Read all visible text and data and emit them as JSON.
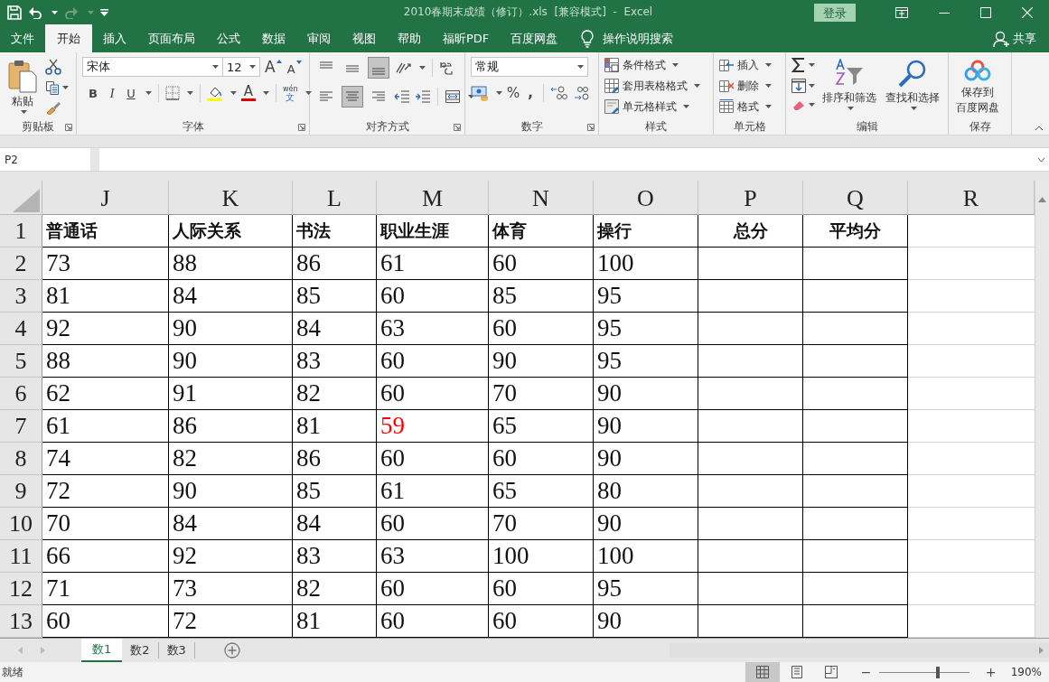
{
  "window": {
    "title": "2010春期末成绩（修订）.xls  [兼容模式]  -  Excel",
    "login": "登录"
  },
  "menu_tabs": [
    {
      "label": "文件",
      "selected": false
    },
    {
      "label": "开始",
      "selected": true
    },
    {
      "label": "插入",
      "selected": false
    },
    {
      "label": "页面布局",
      "selected": false
    },
    {
      "label": "公式",
      "selected": false
    },
    {
      "label": "数据",
      "selected": false
    },
    {
      "label": "审阅",
      "selected": false
    },
    {
      "label": "视图",
      "selected": false
    },
    {
      "label": "帮助",
      "selected": false
    },
    {
      "label": "福昕PDF",
      "selected": false
    },
    {
      "label": "百度网盘",
      "selected": false
    }
  ],
  "tell_me": "操作说明搜索",
  "share": "共享",
  "ribbon": {
    "clipboard": {
      "label": "剪贴板",
      "paste": "粘贴"
    },
    "font": {
      "label": "字体",
      "font_name": "宋体",
      "font_size": "12",
      "grow": "A",
      "shrink": "A",
      "bold": "B",
      "italic": "I",
      "underline": "U",
      "font_color": "A",
      "phonetic_top": "wén",
      "phonetic_bottom": "文"
    },
    "alignment": {
      "label": "对齐方式",
      "vertical": [
        {
          "selected": false
        },
        {
          "selected": false
        },
        {
          "selected": true
        }
      ],
      "horizontal": [
        {
          "selected": false
        },
        {
          "selected": true
        },
        {
          "selected": false
        }
      ]
    },
    "number": {
      "label": "数字",
      "format": "常规",
      "percent": "%",
      "comma": ","
    },
    "styles": {
      "label": "样式",
      "items": [
        "条件格式",
        "套用表格格式",
        "单元格样式"
      ]
    },
    "cells": {
      "label": "单元格",
      "items": [
        "插入",
        "删除",
        "格式"
      ]
    },
    "editing": {
      "label": "编辑",
      "sort": "排序和筛选",
      "find": "查找和选择"
    },
    "save": {
      "label": "保存",
      "lines": [
        "保存到",
        "百度网盘"
      ]
    }
  },
  "formula_bar": {
    "name_box": "P2"
  },
  "sheet": {
    "columns": [
      "J",
      "K",
      "L",
      "M",
      "N",
      "O",
      "P",
      "Q",
      "R"
    ],
    "rows": [
      {
        "row": "1",
        "kind": "header",
        "cells": [
          {
            "text": "普通话",
            "centered": false
          },
          {
            "text": "人际关系",
            "centered": false
          },
          {
            "text": "书法",
            "centered": false
          },
          {
            "text": "职业生涯",
            "centered": false
          },
          {
            "text": "体育",
            "centered": false
          },
          {
            "text": "操行",
            "centered": false
          },
          {
            "text": "总分",
            "centered": true
          },
          {
            "text": "平均分",
            "centered": true
          }
        ]
      },
      {
        "row": "2",
        "kind": "data",
        "cells": [
          {
            "text": "73",
            "red": false
          },
          {
            "text": "88",
            "red": false
          },
          {
            "text": "86",
            "red": false
          },
          {
            "text": "61",
            "red": false
          },
          {
            "text": "60",
            "red": false
          },
          {
            "text": "100",
            "red": false
          }
        ]
      },
      {
        "row": "3",
        "kind": "data",
        "cells": [
          {
            "text": "81",
            "red": false
          },
          {
            "text": "84",
            "red": false
          },
          {
            "text": "85",
            "red": false
          },
          {
            "text": "60",
            "red": false
          },
          {
            "text": "85",
            "red": false
          },
          {
            "text": "95",
            "red": false
          }
        ]
      },
      {
        "row": "4",
        "kind": "data",
        "cells": [
          {
            "text": "92",
            "red": false
          },
          {
            "text": "90",
            "red": false
          },
          {
            "text": "84",
            "red": false
          },
          {
            "text": "63",
            "red": false
          },
          {
            "text": "60",
            "red": false
          },
          {
            "text": "95",
            "red": false
          }
        ]
      },
      {
        "row": "5",
        "kind": "data",
        "cells": [
          {
            "text": "88",
            "red": false
          },
          {
            "text": "90",
            "red": false
          },
          {
            "text": "83",
            "red": false
          },
          {
            "text": "60",
            "red": false
          },
          {
            "text": "90",
            "red": false
          },
          {
            "text": "95",
            "red": false
          }
        ]
      },
      {
        "row": "6",
        "kind": "data",
        "cells": [
          {
            "text": "62",
            "red": false
          },
          {
            "text": "91",
            "red": false
          },
          {
            "text": "82",
            "red": false
          },
          {
            "text": "60",
            "red": false
          },
          {
            "text": "70",
            "red": false
          },
          {
            "text": "90",
            "red": false
          }
        ]
      },
      {
        "row": "7",
        "kind": "data",
        "cells": [
          {
            "text": "61",
            "red": false
          },
          {
            "text": "86",
            "red": false
          },
          {
            "text": "81",
            "red": false
          },
          {
            "text": "59",
            "red": true
          },
          {
            "text": "65",
            "red": false
          },
          {
            "text": "90",
            "red": false
          }
        ]
      },
      {
        "row": "8",
        "kind": "data",
        "cells": [
          {
            "text": "74",
            "red": false
          },
          {
            "text": "82",
            "red": false
          },
          {
            "text": "86",
            "red": false
          },
          {
            "text": "60",
            "red": false
          },
          {
            "text": "60",
            "red": false
          },
          {
            "text": "90",
            "red": false
          }
        ]
      },
      {
        "row": "9",
        "kind": "data",
        "cells": [
          {
            "text": "72",
            "red": false
          },
          {
            "text": "90",
            "red": false
          },
          {
            "text": "85",
            "red": false
          },
          {
            "text": "61",
            "red": false
          },
          {
            "text": "65",
            "red": false
          },
          {
            "text": "80",
            "red": false
          }
        ]
      },
      {
        "row": "10",
        "kind": "data",
        "cells": [
          {
            "text": "70",
            "red": false
          },
          {
            "text": "84",
            "red": false
          },
          {
            "text": "84",
            "red": false
          },
          {
            "text": "60",
            "red": false
          },
          {
            "text": "70",
            "red": false
          },
          {
            "text": "90",
            "red": false
          }
        ]
      },
      {
        "row": "11",
        "kind": "data",
        "cells": [
          {
            "text": "66",
            "red": false
          },
          {
            "text": "92",
            "red": false
          },
          {
            "text": "83",
            "red": false
          },
          {
            "text": "63",
            "red": false
          },
          {
            "text": "100",
            "red": false
          },
          {
            "text": "100",
            "red": false
          }
        ]
      },
      {
        "row": "12",
        "kind": "data",
        "cells": [
          {
            "text": "71",
            "red": false
          },
          {
            "text": "73",
            "red": false
          },
          {
            "text": "82",
            "red": false
          },
          {
            "text": "60",
            "red": false
          },
          {
            "text": "60",
            "red": false
          },
          {
            "text": "95",
            "red": false
          }
        ]
      },
      {
        "row": "13",
        "kind": "data",
        "cells": [
          {
            "text": "60",
            "red": false
          },
          {
            "text": "72",
            "red": false
          },
          {
            "text": "81",
            "red": false
          },
          {
            "text": "60",
            "red": false
          },
          {
            "text": "60",
            "red": false
          },
          {
            "text": "90",
            "red": false
          }
        ]
      }
    ]
  },
  "sheet_tabs": [
    {
      "label": "数1",
      "selected": true
    },
    {
      "label": "数2",
      "selected": false
    },
    {
      "label": "数3",
      "selected": false
    }
  ],
  "status_bar": {
    "status": "就绪",
    "views": [
      {
        "selected": true
      },
      {
        "selected": false
      },
      {
        "selected": false
      }
    ],
    "minus": "−",
    "plus": "+",
    "zoom_slider": {
      "level": 0.65
    },
    "zoom": "190%"
  }
}
